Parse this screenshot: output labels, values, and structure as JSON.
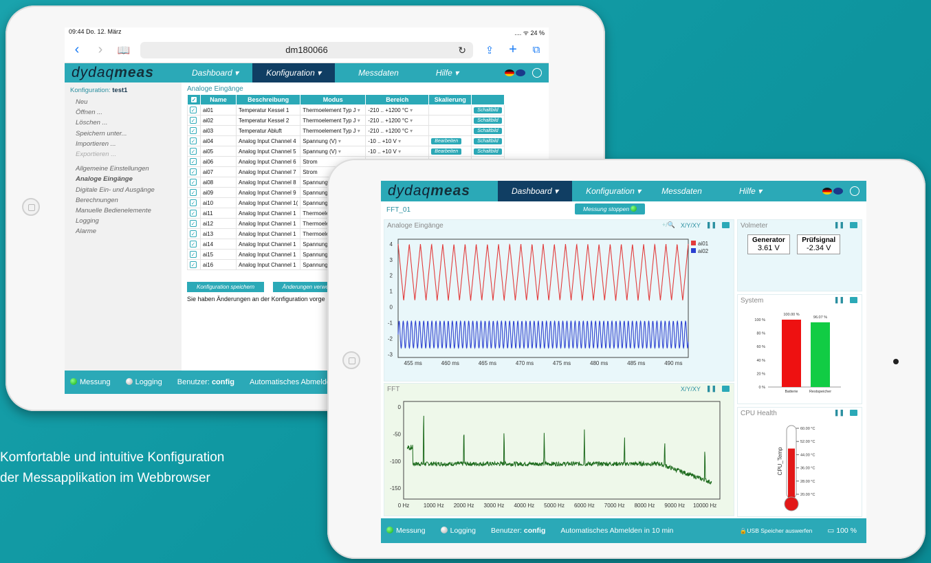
{
  "caption": {
    "line1": "Komfortable und intuitive Konfiguration",
    "line2": "der Messapplikation im Webbrowser"
  },
  "tablet1": {
    "status_time": "09:44  Do. 12. März",
    "status_right": "....  ᯤ 24 %",
    "url": "dm180066",
    "logo_pre": "dydaq",
    "logo_bold": "meas",
    "menu": [
      "Dashboard ▾",
      "Konfiguration ▾",
      "Messdaten",
      "Hilfe ▾"
    ],
    "sidebar": {
      "head_label": "Konfiguration: ",
      "head_name": "test1",
      "items": [
        "Neu",
        "Öffnen ...",
        "Löschen ...",
        "Speichern unter...",
        "Importieren ...",
        "Exportieren ..."
      ],
      "items2": [
        "Allgemeine Einstellungen",
        "Analoge Eingänge",
        "Digitale Ein- und Ausgänge",
        "Berechnungen",
        "Manuelle Bedienelemente",
        "Logging",
        "Alarme"
      ]
    },
    "section_title": "Analoge Eingänge",
    "table_headers": [
      "",
      "Name",
      "Beschreibung",
      "Modus",
      "Bereich",
      "Skalierung",
      ""
    ],
    "rows": [
      {
        "name": "ai01",
        "desc": "Temperatur Kessel 1",
        "mode": "Thermoelement Typ J",
        "range": "-210 .. +1200 °C",
        "edit": "",
        "btn": "Schaltbild"
      },
      {
        "name": "ai02",
        "desc": "Temperatur Kessel 2",
        "mode": "Thermoelement Typ J",
        "range": "-210 .. +1200 °C",
        "edit": "",
        "btn": "Schaltbild"
      },
      {
        "name": "ai03",
        "desc": "Temperatur Abluft",
        "mode": "Thermoelement Typ J",
        "range": "-210 .. +1200 °C",
        "edit": "",
        "btn": "Schaltbild"
      },
      {
        "name": "ai04",
        "desc": "Analog Input Channel 4",
        "mode": "Spannung (V)",
        "range": "-10 .. +10 V",
        "edit": "Bearbeiten",
        "btn": "Schaltbild"
      },
      {
        "name": "ai05",
        "desc": "Analog Input Channel 5",
        "mode": "Spannung (V)",
        "range": "-10 .. +10 V",
        "edit": "Bearbeiten",
        "btn": "Schaltbild"
      },
      {
        "name": "ai06",
        "desc": "Analog Input Channel 6",
        "mode": "Strom",
        "range": "",
        "edit": "",
        "btn": ""
      },
      {
        "name": "ai07",
        "desc": "Analog Input Channel 7",
        "mode": "Strom",
        "range": "",
        "edit": "",
        "btn": ""
      },
      {
        "name": "ai08",
        "desc": "Analog Input Channel 8",
        "mode": "Spannung (",
        "range": "",
        "edit": "",
        "btn": ""
      },
      {
        "name": "ai09",
        "desc": "Analog Input Channel 9",
        "mode": "Spannung (",
        "range": "",
        "edit": "",
        "btn": ""
      },
      {
        "name": "ai10",
        "desc": "Analog Input Channel 1(",
        "mode": "Spannung (",
        "range": "",
        "edit": "",
        "btn": ""
      },
      {
        "name": "ai11",
        "desc": "Analog Input Channel 1",
        "mode": "Thermoelem",
        "range": "",
        "edit": "",
        "btn": ""
      },
      {
        "name": "ai12",
        "desc": "Analog Input Channel 1",
        "mode": "Thermoelem",
        "range": "",
        "edit": "",
        "btn": ""
      },
      {
        "name": "ai13",
        "desc": "Analog Input Channel 1",
        "mode": "Thermoelem",
        "range": "",
        "edit": "",
        "btn": ""
      },
      {
        "name": "ai14",
        "desc": "Analog Input Channel 1",
        "mode": "Spannung (",
        "range": "",
        "edit": "",
        "btn": ""
      },
      {
        "name": "ai15",
        "desc": "Analog Input Channel 1",
        "mode": "Spannung (",
        "range": "",
        "edit": "",
        "btn": ""
      },
      {
        "name": "ai16",
        "desc": "Analog Input Channel 1",
        "mode": "Spannung (",
        "range": "",
        "edit": "",
        "btn": ""
      }
    ],
    "save_btn": "Konfiguration speichern",
    "discard_btn": "Änderungen verwerfen",
    "warning": "Sie haben Änderungen an der Konfiguration vorge",
    "footer": {
      "messung": "Messung",
      "logging": "Logging",
      "user_label": "Benutzer: ",
      "user": "config",
      "logout": "Automatisches Abmelden"
    }
  },
  "tablet2": {
    "logo_pre": "dydaq",
    "logo_bold": "meas",
    "menu": [
      "Dashboard ▾",
      "Konfiguration ▾",
      "Messdaten",
      "Hilfe ▾"
    ],
    "page_name": "FFT_01",
    "stop_btn": "Messung stoppen",
    "analog_title": "Analoge Eingänge",
    "fft_title": "FFT",
    "xy_label": "X/Y/XY",
    "voltmeter": {
      "title": "Volmeter",
      "gen_label": "Generator",
      "gen_value": "3.61 V",
      "sig_label": "Prüfsignal",
      "sig_value": "-2.34 V"
    },
    "system": {
      "title": "System"
    },
    "cpu": {
      "title": "CPU Health",
      "value": "47.70 °C",
      "axis_label": "CPU_Temp"
    },
    "footer": {
      "messung": "Messung",
      "logging": "Logging",
      "user_label": "Benutzer: ",
      "user": "config",
      "logout": "Automatisches Abmelden in 10 min",
      "usb": "USB Speicher auswerfen",
      "battery": "100 %"
    }
  },
  "chart_data": [
    {
      "type": "line",
      "title": "Analoge Eingänge",
      "x_ticks": [
        "455 ms",
        "460 ms",
        "465 ms",
        "470 ms",
        "475 ms",
        "480 ms",
        "485 ms",
        "490 ms"
      ],
      "xlim": [
        453,
        492
      ],
      "ylim": [
        -3.2,
        4.3
      ],
      "y_ticks": [
        4,
        3,
        2,
        1,
        0,
        -1,
        -2,
        -3
      ],
      "series": [
        {
          "name": "ai01",
          "color": "#e23b3b",
          "shape": "triangle",
          "min": 0.4,
          "max": 4.0,
          "period_ms": 1.5
        },
        {
          "name": "ai02",
          "color": "#2a3fd0",
          "shape": "sine",
          "min": -2.6,
          "max": -0.9,
          "period_ms": 0.55
        }
      ],
      "legend": "top-right"
    },
    {
      "type": "line",
      "title": "FFT",
      "x_ticks": [
        "0 Hz",
        "1000 Hz",
        "2000 Hz",
        "3000 Hz",
        "4000 Hz",
        "5000 Hz",
        "6000 Hz",
        "7000 Hz",
        "8000 Hz",
        "9000 Hz",
        "10000 Hz"
      ],
      "xlim": [
        0,
        10500
      ],
      "ylim": [
        -170,
        10
      ],
      "y_ticks": [
        0,
        -50,
        -100,
        -150
      ],
      "series": [
        {
          "name": "FFT",
          "color": "#1d6b1d",
          "peaks_hz": [
            667,
            2000,
            3333,
            4667,
            6000,
            7333,
            8667,
            10000
          ],
          "peaks_db": [
            -5,
            -30,
            -35,
            -40,
            -40,
            -45,
            -50,
            -65
          ],
          "noise_db": -105
        }
      ]
    },
    {
      "type": "bar",
      "title": "System",
      "categories": [
        "Batterie",
        "Restspeicher"
      ],
      "values": [
        100.0,
        96.07
      ],
      "value_labels": [
        "100.00 %",
        "96.07 %"
      ],
      "colors": [
        "#ee1111",
        "#11cc44"
      ],
      "y_ticks": [
        "100 %",
        "80 %",
        "60 %",
        "40 %",
        "20 %",
        "0 %"
      ],
      "ylim": [
        0,
        100
      ]
    },
    {
      "type": "bar",
      "title": "CPU Health",
      "categories": [
        "CPU_Temp"
      ],
      "values": [
        47.7
      ],
      "y_ticks": [
        "60.00 °C",
        "52.00 °C",
        "44.00 °C",
        "36.00 °C",
        "28.00 °C",
        "20.00 °C"
      ],
      "ylim": [
        20,
        60
      ]
    }
  ]
}
